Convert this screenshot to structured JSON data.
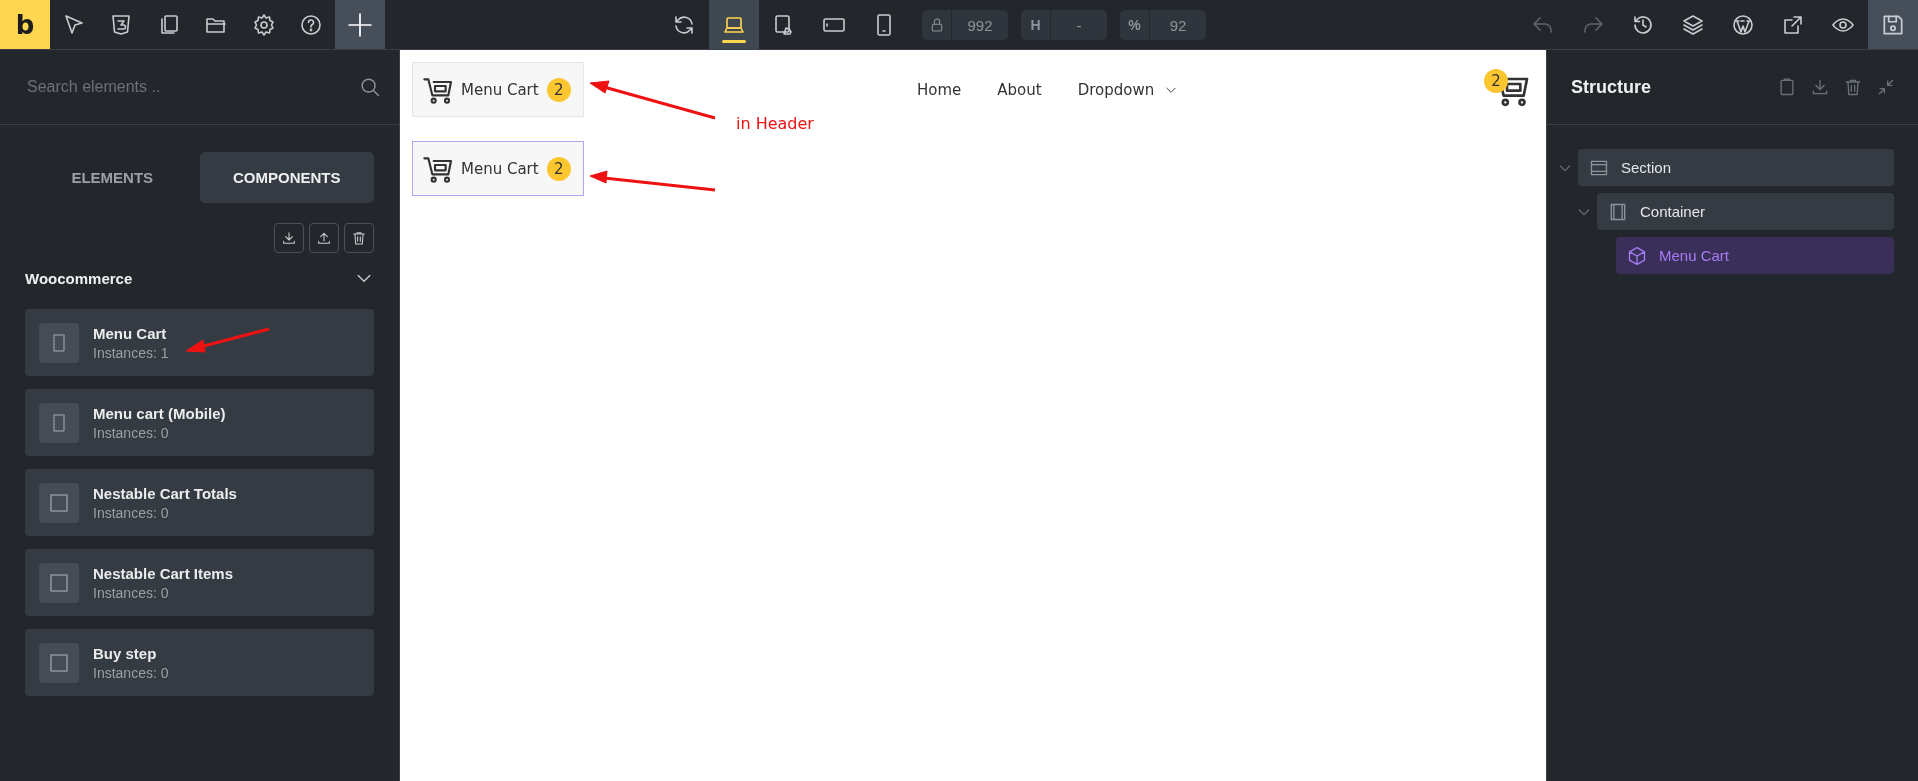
{
  "toolbar": {
    "logo": "b",
    "devices": [
      {
        "kind": "laptop",
        "selected": true
      },
      {
        "kind": "tablet-portrait",
        "selected": false
      },
      {
        "kind": "tablet-landscape",
        "selected": false
      },
      {
        "kind": "mobile",
        "selected": false
      }
    ],
    "fields": [
      {
        "kind": "width",
        "value": "992"
      },
      {
        "kind": "height",
        "label": "H",
        "value": "-"
      },
      {
        "kind": "zoom",
        "label": "%",
        "value": "92"
      }
    ]
  },
  "elements_panel": {
    "search": {
      "placeholder": "Search elements .."
    },
    "tabs": [
      {
        "label": "ELEMENTS",
        "selected": false
      },
      {
        "label": "COMPONENTS",
        "selected": true
      }
    ],
    "category": {
      "title": "Woocommerce",
      "expanded": true
    },
    "components": [
      {
        "name": "Menu Cart",
        "instances": "Instances: 1",
        "kind": "frame"
      },
      {
        "name": "Menu cart (Mobile)",
        "instances": "Instances: 0",
        "kind": "frame"
      },
      {
        "name": "Nestable Cart Totals",
        "instances": "Instances: 0",
        "kind": "square"
      },
      {
        "name": "Nestable Cart Items",
        "instances": "Instances: 0",
        "kind": "square"
      },
      {
        "name": "Buy step",
        "instances": "Instances: 0",
        "kind": "square"
      }
    ]
  },
  "canvas": {
    "header": {
      "menu_cart": {
        "label": "Menu Cart",
        "count": "2",
        "selected": false
      },
      "nav": [
        {
          "label": "Home",
          "dropdown": false
        },
        {
          "label": "About",
          "dropdown": false
        },
        {
          "label": "Dropdown",
          "dropdown": true
        }
      ],
      "cart_count": "2"
    },
    "body": {
      "menu_cart": {
        "label": "Menu Cart",
        "count": "2",
        "selected": true
      }
    },
    "annotation": "in Header"
  },
  "structure": {
    "title": "Structure",
    "tree": [
      {
        "label": "Section",
        "kind": "section",
        "expanded": true,
        "selected": false,
        "children": [
          {
            "label": "Container",
            "kind": "container",
            "expanded": true,
            "selected": false,
            "children": [
              {
                "label": "Menu Cart",
                "kind": "component",
                "selected": true
              }
            ]
          }
        ]
      }
    ]
  }
}
